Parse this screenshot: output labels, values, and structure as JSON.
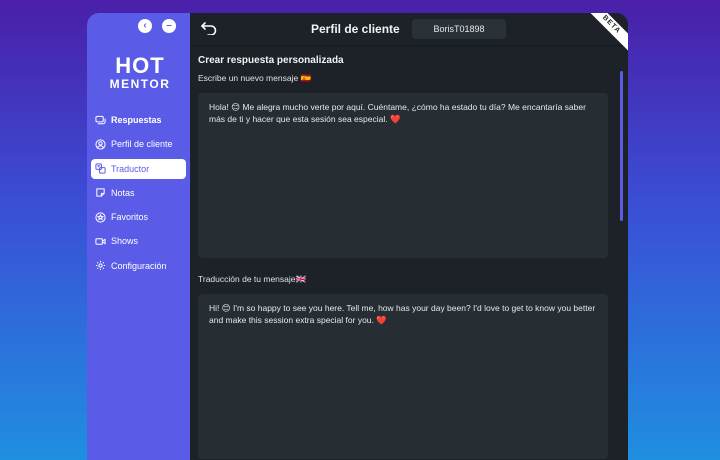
{
  "sidebar": {
    "logo_line1": "HOT",
    "logo_line2": "MENTOR",
    "items": [
      {
        "label": "Respuestas",
        "icon": "chat-icon"
      },
      {
        "label": "Perfil de cliente",
        "icon": "user-icon"
      },
      {
        "label": "Traductor",
        "icon": "translate-icon"
      },
      {
        "label": "Notas",
        "icon": "notes-icon"
      },
      {
        "label": "Favoritos",
        "icon": "favorites-icon"
      },
      {
        "label": "Shows",
        "icon": "video-icon"
      },
      {
        "label": "Configuración",
        "icon": "gear-icon"
      }
    ],
    "active_index": 2,
    "accent": "#5a5ce8"
  },
  "header": {
    "title": "Perfil de cliente",
    "client_id": "BorisT01898",
    "badge": "BETA"
  },
  "main": {
    "section_title": "Crear respuesta personalizada",
    "input_label": "Escribe un nuevo mensaje 🇪🇸",
    "input_text": "Hola! 😊 Me alegra mucho verte por aquí. Cuéntame, ¿cómo ha estado tu día? Me encantaría saber más de ti y hacer que esta sesión sea especial. ❤️",
    "output_label": "Traducción de tu mensaje🇬🇧",
    "output_text": "Hi! 😊 I'm so happy to see you here. Tell me, how has your day been? I'd love to get to know you better and make this session extra special for you. ❤️"
  }
}
